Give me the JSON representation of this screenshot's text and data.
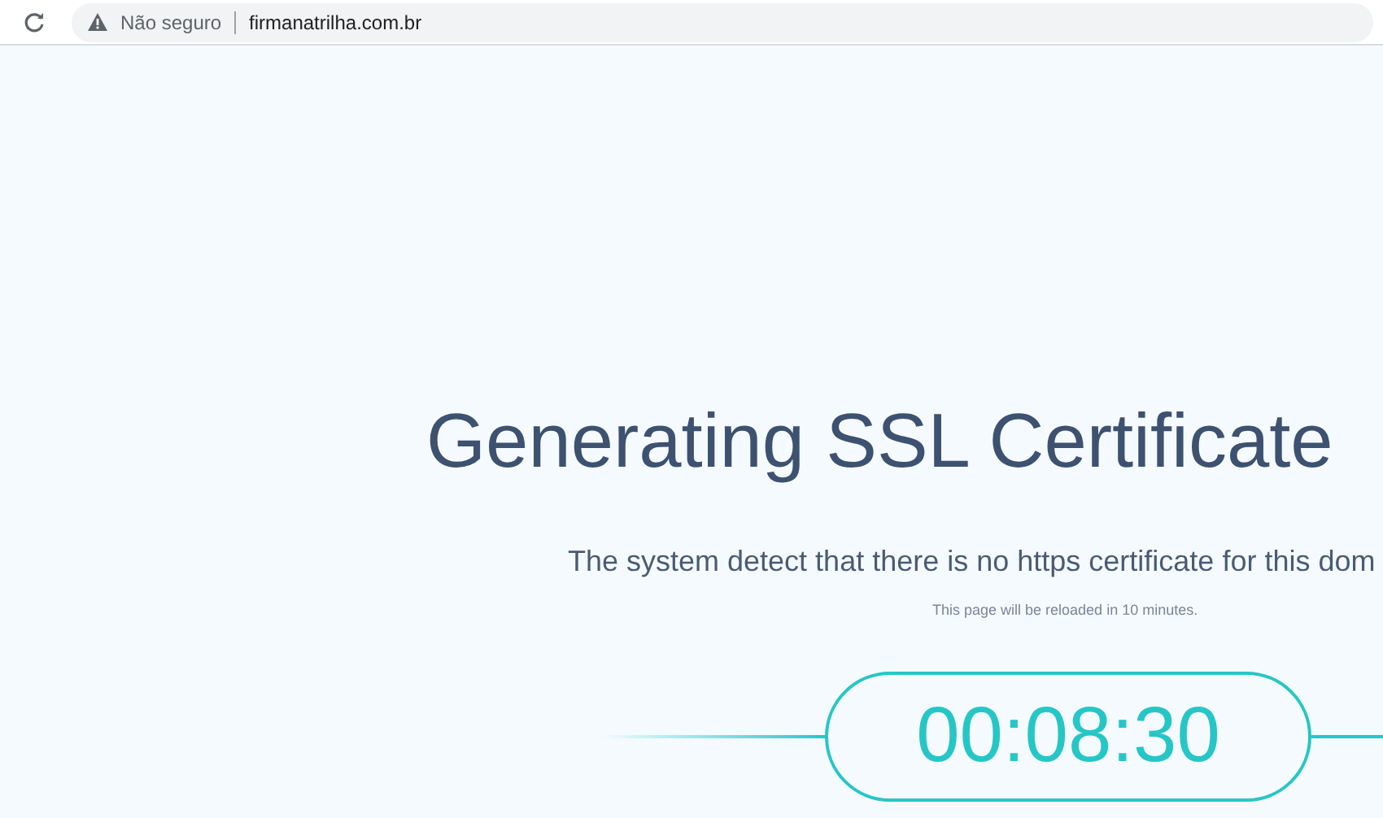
{
  "browser_bar": {
    "security_label": "Não seguro",
    "url": "firmanatrilha.com.br"
  },
  "page": {
    "title": "Generating SSL Certificate",
    "message": "The system detect that there is no https certificate for this dom",
    "note": "This page will be reloaded in 10 minutes.",
    "timer": "00:08:30"
  }
}
